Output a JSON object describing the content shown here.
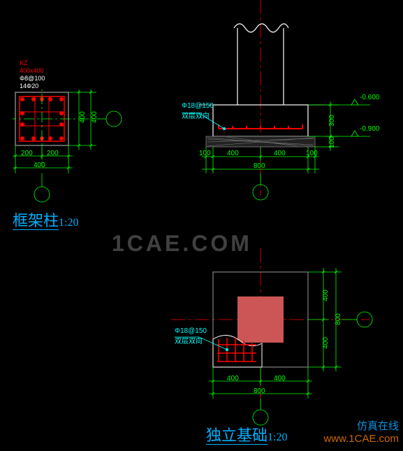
{
  "col": {
    "label_kz": "KZ",
    "label_size": "400x400",
    "label_stirrup": "Φ8@100",
    "label_bars": "14Φ20",
    "dim_200_a": "200",
    "dim_200_b": "200",
    "dim_400_b": "400",
    "dim_400_r1": "400",
    "dim_400_r2": "400",
    "title": "框架柱",
    "scale": "1:20"
  },
  "sec": {
    "rebar_note": "Φ18@150\n双层双向",
    "dim_100_l": "100",
    "dim_400_a": "400",
    "dim_400_b": "400",
    "dim_100_r": "100",
    "dim_800": "800",
    "dim_300": "300",
    "dim_100_v": "100",
    "level_top": "-0.600",
    "level_bot": "-0.900"
  },
  "plan": {
    "rebar_note": "Φ18@150\n双层双向",
    "dim_400_b1": "400",
    "dim_400_b2": "400",
    "dim_800_b": "800",
    "dim_400_r1": "400",
    "dim_400_r2": "400",
    "dim_800_r": "800",
    "title": "独立基础",
    "scale": "1:20"
  },
  "watermark": "1CAE.COM",
  "footer1": "仿真在线",
  "footer2": "www.1CAE.com"
}
